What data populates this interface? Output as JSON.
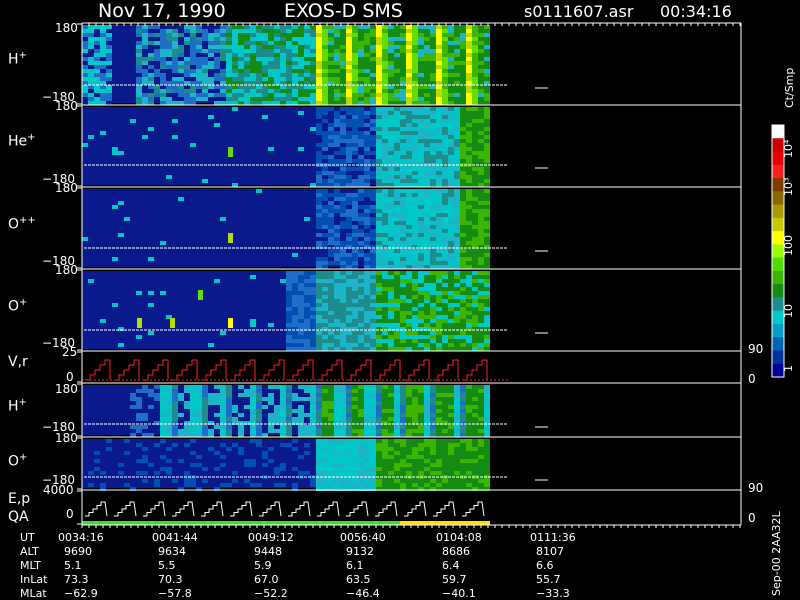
{
  "header": {
    "date": "Nov 17, 1990",
    "instrument": "EXOS-D SMS",
    "file": "s0111607.asr",
    "time": "00:34:16"
  },
  "panels": [
    {
      "id": "hplus",
      "label_base": "H",
      "label_sup": "+",
      "ytop": "180",
      "ybot": "−180"
    },
    {
      "id": "heplus",
      "label_base": "He",
      "label_sup": "+",
      "ytop": "180",
      "ybot": "−180"
    },
    {
      "id": "oplusplus",
      "label_base": "O",
      "label_sup": "++",
      "ytop": "180",
      "ybot": "−180"
    },
    {
      "id": "oplus",
      "label_base": "O",
      "label_sup": "+",
      "ytop": "180",
      "ybot": "−180"
    },
    {
      "id": "vr",
      "label_base": "V,r",
      "label_sup": "",
      "ytop": "25",
      "ybot": "0",
      "right_top": "90",
      "right_bot": "0"
    },
    {
      "id": "hplus2",
      "label_base": "H",
      "label_sup": "+",
      "ytop": "180",
      "ybot": "−180"
    },
    {
      "id": "oplus2",
      "label_base": "O",
      "label_sup": "+",
      "ytop": "180",
      "ybot": "−180"
    },
    {
      "id": "ep",
      "label_base": "E,p",
      "label_sup": "",
      "label2": "QA",
      "ytop": "4000",
      "ybot": "0",
      "right_top": "90",
      "right_bot": "0"
    }
  ],
  "colorbar": {
    "unit": "Ct/Smp",
    "ticks": [
      "10⁴",
      "10³",
      "100",
      "10",
      "1"
    ],
    "colors": [
      "#ffffff",
      "#c80000",
      "#e80000",
      "#ff2020",
      "#7a3c00",
      "#8a6a00",
      "#a89a00",
      "#c8c800",
      "#ffff00",
      "#9aff00",
      "#50dc00",
      "#3cb400",
      "#148c14",
      "#1e8c8c",
      "#00c8c8",
      "#00a0c8",
      "#0064b4",
      "#0032a0",
      "#000096"
    ]
  },
  "footer": {
    "rows": [
      {
        "label": "UT",
        "values": [
          "0034:16",
          "0041:44",
          "0049:12",
          "0056:40",
          "0104:08",
          "0111:36"
        ]
      },
      {
        "label": "ALT",
        "values": [
          "9690",
          "9634",
          "9448",
          "9132",
          "8686",
          "8107"
        ]
      },
      {
        "label": "MLT",
        "values": [
          "5.1",
          "5.5",
          "5.9",
          "6.1",
          "6.4",
          "6.6"
        ]
      },
      {
        "label": "InLat",
        "values": [
          "73.3",
          "70.3",
          "67.0",
          "63.5",
          "59.7",
          "55.7"
        ]
      },
      {
        "label": "MLat",
        "values": [
          "−62.9",
          "−57.8",
          "−52.2",
          "−46.4",
          "−40.1",
          "−33.3"
        ]
      }
    ],
    "version": "Sep-00 2AA32L"
  },
  "chart_data": {
    "type": "heatmap",
    "title": "Nov 17, 1990   EXOS-D SMS",
    "xlabel": "UT",
    "x_ticks": [
      "0034:16",
      "0041:44",
      "0049:12",
      "0056:40",
      "0104:08",
      "0111:36"
    ],
    "colorbar_unit": "Ct/Smp",
    "colorbar_scale": "log",
    "colorbar_range": [
      1,
      10000
    ],
    "spectrogram_panels": [
      "H+",
      "He+",
      "O++",
      "O+",
      "H+",
      "O+"
    ],
    "pitch_angle_range": [
      -180,
      180
    ],
    "line_panels": [
      {
        "label": "V,r",
        "ylim": [
          0,
          25
        ],
        "right_axis": [
          0,
          90
        ]
      },
      {
        "label": "E,p",
        "ylim": [
          0,
          4000
        ],
        "right_axis": [
          0,
          90
        ]
      }
    ],
    "grid": false
  }
}
